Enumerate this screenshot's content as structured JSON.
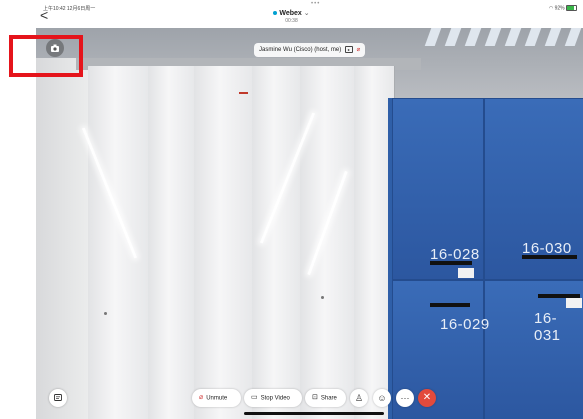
{
  "status_bar": {
    "time": "上午10:42  12月6日周一",
    "right": "92%"
  },
  "header": {
    "back_symbol": "<",
    "title": "Webex",
    "timer": "00:38"
  },
  "video": {
    "participant_label": "Jasmine Wu (Cisco) (host, me)",
    "locker_numbers": [
      "16-028",
      "16-030",
      "16-029",
      "16-031"
    ]
  },
  "toolbar": {
    "unmute_label": "Unmute",
    "stop_video_label": "Stop Video",
    "share_label": "Share",
    "more_symbol": "···",
    "end_symbol": "✕"
  },
  "colors": {
    "accent": "#00a0d1",
    "end_call": "#e24a3c",
    "highlight": "#e5141b",
    "muted": "#d23b3b"
  }
}
